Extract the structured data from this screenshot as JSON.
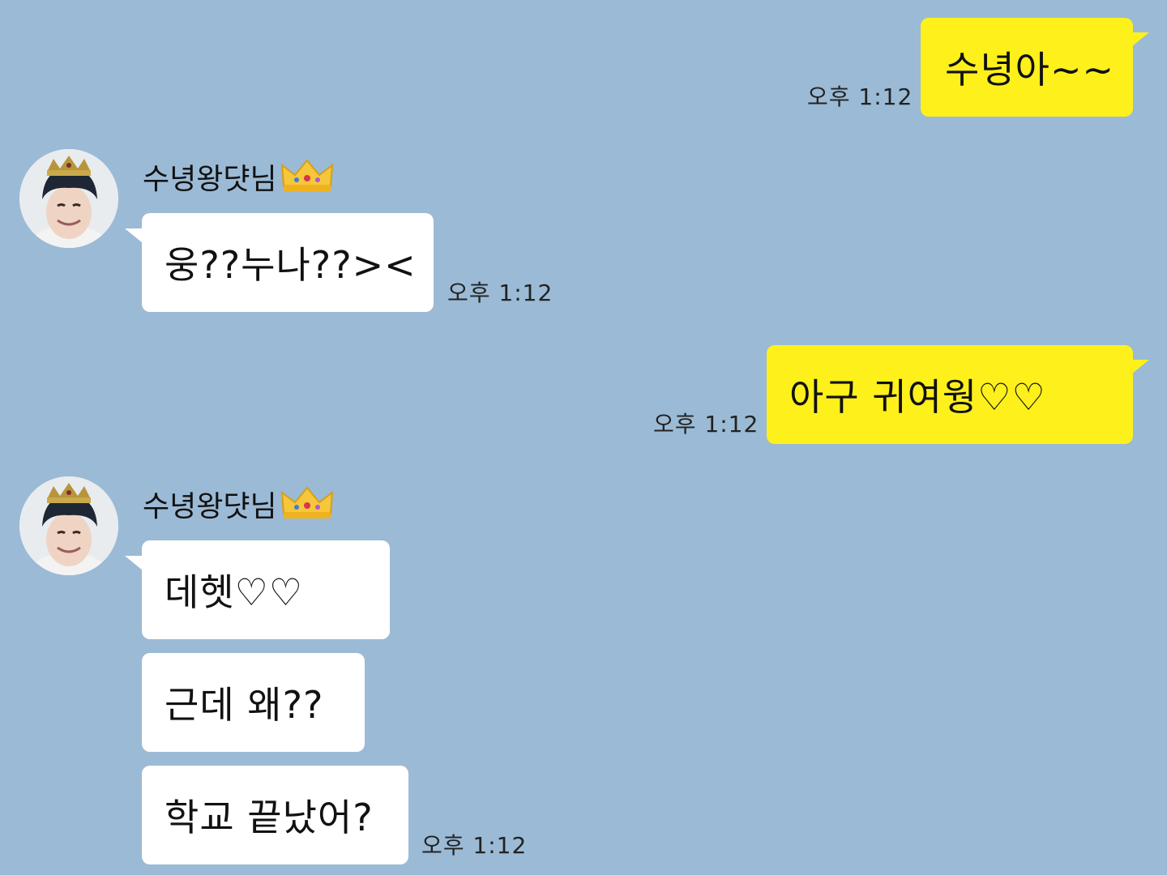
{
  "colors": {
    "background": "#9bbad5",
    "my_bubble": "#fef01b",
    "their_bubble": "#ffffff"
  },
  "messages": [
    {
      "from": "me",
      "text": "수녕아~~",
      "time": "오후 1:12"
    },
    {
      "from": "them",
      "sender": "수녕왕댯님",
      "text": "웅??누나??><",
      "time": "오후 1:12",
      "avatar": "profile-photo-crown"
    },
    {
      "from": "me",
      "text": "아구 귀여웡♡♡",
      "time": "오후 1:12"
    },
    {
      "from": "them",
      "sender": "수녕왕댯님",
      "text": "데헷♡♡",
      "avatar": "profile-photo-crown"
    },
    {
      "from": "them",
      "text": "근데 왜??"
    },
    {
      "from": "them",
      "text": "학교 끝났어?",
      "time": "오후 1:12"
    }
  ],
  "icons": {
    "crown_badge": "crown-emoji-icon"
  }
}
